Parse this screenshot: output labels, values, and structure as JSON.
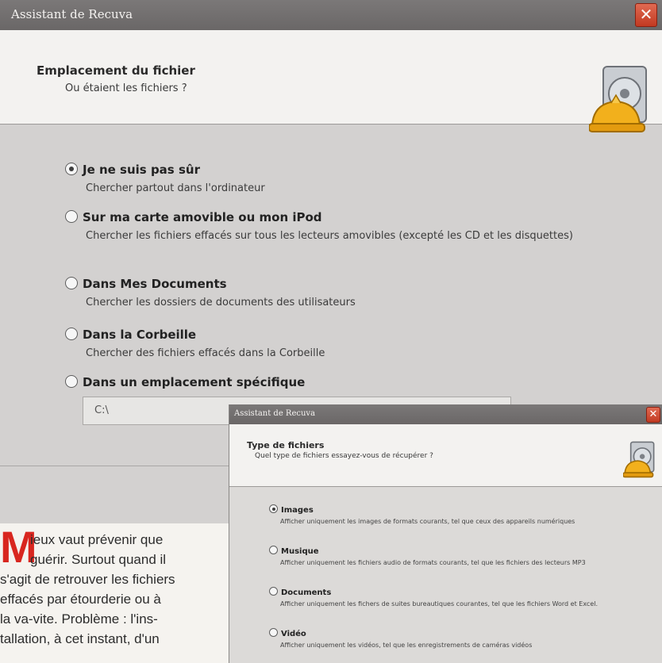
{
  "main_wizard": {
    "title": "Assistant de Recuva",
    "close_glyph": "✕",
    "header_title": "Emplacement du fichier",
    "header_subtitle": "Ou étaient les fichiers ?",
    "options": [
      {
        "label": "Je ne suis pas sûr",
        "description": "Chercher partout dans l'ordinateur",
        "selected": true
      },
      {
        "label": "Sur ma carte amovible ou mon iPod",
        "description": "Chercher les fichiers effacés sur tous les lecteurs amovibles (excepté les CD et les disquettes)",
        "selected": false
      },
      {
        "label": "Dans Mes Documents",
        "description": "Chercher les dossiers de documents des utilisateurs",
        "selected": false
      },
      {
        "label": "Dans la Corbeille",
        "description": "Chercher des fichiers effacés dans la Corbeille",
        "selected": false
      },
      {
        "label": "Dans un emplacement spécifique",
        "description": "",
        "selected": false
      }
    ],
    "path_value": "C:\\"
  },
  "type_wizard": {
    "title": "Assistant de Recuva",
    "close_glyph": "✕",
    "header_title": "Type de fichiers",
    "header_subtitle": "Quel type de fichiers essayez-vous de récupérer ?",
    "options": [
      {
        "label": "Images",
        "description": "Afficher uniquement les images de formats courants, tel que ceux des appareils numériques",
        "selected": true
      },
      {
        "label": "Musique",
        "description": "Afficher uniquement les fichiers audio de formats courants, tel que les fichiers des lecteurs MP3",
        "selected": false
      },
      {
        "label": "Documents",
        "description": "Afficher uniquement les fichers de suites bureautiques courantes, tel que les fichiers Word et Excel.",
        "selected": false
      },
      {
        "label": "Vidéo",
        "description": "Afficher uniquement les vidéos, tel que les enregistrements de caméras vidéos",
        "selected": false
      }
    ]
  },
  "article": {
    "drop_cap": "M",
    "lines": [
      "ieux vaut prévenir que",
      "guérir. Surtout quand il",
      "s'agit de retrouver les fichiers",
      "effacés par étourderie ou à",
      "la va-vite. Problème : l'ins-",
      "tallation, à cet instant, d'un"
    ]
  },
  "colors": {
    "accent_red": "#d8261f",
    "titlebar": "#6f6c6c",
    "close": "#c8412a"
  }
}
